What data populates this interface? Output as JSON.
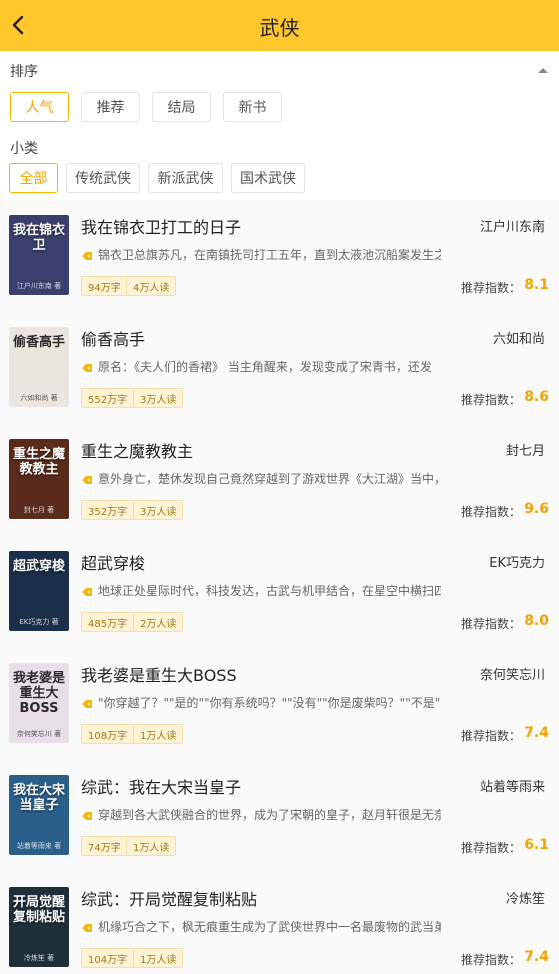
{
  "header": {
    "title": "武侠"
  },
  "filter": {
    "sort_label": "排序",
    "sort_options": [
      {
        "label": "人气",
        "active": true
      },
      {
        "label": "推荐",
        "active": false
      },
      {
        "label": "结局",
        "active": false
      },
      {
        "label": "新书",
        "active": false
      }
    ],
    "category_label": "小类",
    "category_options": [
      {
        "label": "全部",
        "active": true
      },
      {
        "label": "传统武侠",
        "active": false
      },
      {
        "label": "新派武侠",
        "active": false
      },
      {
        "label": "国术武侠",
        "active": false
      }
    ]
  },
  "score_label": "推荐指数：",
  "books": [
    {
      "title": "我在锦衣卫打工的日子",
      "author": "江户川东南",
      "description": "锦衣卫总旗苏凡，在南镇抚司打工五年，直到太液池沉船案发生之后",
      "words": "94万字",
      "readers": "4万人读",
      "score": "8.1",
      "cover_text": "我在锦衣卫",
      "cover_sub": "江户川东南 著",
      "cover_color": "#3a3f6e"
    },
    {
      "title": "偷香高手",
      "author": "六如和尚",
      "description": "原名：《夫人们的香裙》 当主角醒来，发现变成了宋青书，还发",
      "words": "552万字",
      "readers": "3万人读",
      "score": "8.6",
      "cover_text": "偷香高手",
      "cover_sub": "六如和尚 著",
      "cover_color": "#e9e6e0"
    },
    {
      "title": "重生之魔教教主",
      "author": "封七月",
      "description": "意外身亡，楚休发现自己竟然穿越到了游戏世界《大江湖》当中，成",
      "words": "352万字",
      "readers": "3万人读",
      "score": "9.6",
      "cover_text": "重生之魔教教主",
      "cover_sub": "封七月 著",
      "cover_color": "#5a2a1a"
    },
    {
      "title": "超武穿梭",
      "author": "EK巧克力",
      "description": "地球正处星际时代，科技发达，古武与机甲结合，在星空中横扫四方",
      "words": "485万字",
      "readers": "2万人读",
      "score": "8.0",
      "cover_text": "超武穿梭",
      "cover_sub": "EK巧克力 著",
      "cover_color": "#1b2f4a"
    },
    {
      "title": "我老婆是重生大BOSS",
      "author": "奈何笑忘川",
      "description": "\"你穿越了？\"\"是的\"\"你有系统吗？\"\"没有\"\"你是废柴吗？\"\"不是\"",
      "words": "108万字",
      "readers": "1万人读",
      "score": "7.4",
      "cover_text": "我老婆是重生大BOSS",
      "cover_sub": "奈何笑忘川 著",
      "cover_color": "#e8dfe8"
    },
    {
      "title": "综武：我在大宋当皇子",
      "author": "站着等雨来",
      "description": "穿越到各大武侠融合的世界，成为了宋朝的皇子，赵月轩很是无奈。",
      "words": "74万字",
      "readers": "1万人读",
      "score": "6.1",
      "cover_text": "我在大宋当皇子",
      "cover_sub": "站着等雨来 著",
      "cover_color": "#2a5f8a"
    },
    {
      "title": "综武：开局觉醒复制粘贴",
      "author": "冷炼笙",
      "description": "机缘巧合之下，枫无痕重生成为了武侠世界中一名最废物的武当弟子",
      "words": "104万字",
      "readers": "1万人读",
      "score": "7.4",
      "cover_text": "开局觉醒复制粘贴",
      "cover_sub": "冷炼笙 著",
      "cover_color": "#1f2f3a"
    }
  ]
}
